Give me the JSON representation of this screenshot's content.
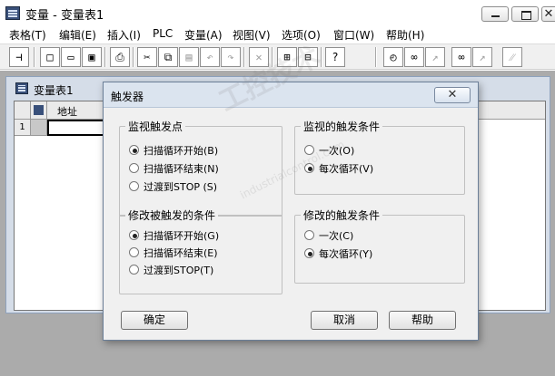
{
  "app": {
    "title": "变量 - 变量表1"
  },
  "menu": [
    "表格(T)",
    "编辑(E)",
    "插入(I)",
    "PLC",
    "变量(A)",
    "视图(V)",
    "选项(O)",
    "窗口(W)",
    "帮助(H)"
  ],
  "child_window": {
    "title": "变量表1",
    "column_address": "地址",
    "row_number": "1"
  },
  "dialog": {
    "title": "触发器",
    "close_glyph": "✕",
    "monitor_trigger_point": {
      "legend": "监视触发点",
      "options": [
        "扫描循环开始(B)",
        "扫描循环结束(N)",
        "过渡到STOP (S)"
      ],
      "selected_index": 0
    },
    "monitor_trigger_condition": {
      "legend": "监视的触发条件",
      "options": [
        "一次(O)",
        "每次循环(V)"
      ],
      "selected_index": 1
    },
    "modify_trigger_point": {
      "legend": "修改被触发的条件",
      "options": [
        "扫描循环开始(G)",
        "扫描循环结束(E)",
        "过渡到STOP(T)"
      ],
      "selected_index": 0
    },
    "modify_trigger_condition": {
      "legend": "修改的触发条件",
      "options": [
        "一次(C)",
        "每次循环(Y)"
      ],
      "selected_index": 1
    },
    "buttons": {
      "ok": "确定",
      "cancel": "取消",
      "help": "帮助"
    }
  },
  "watermark": {
    "line1": "工控技术",
    "line2": "industrialcontrol.com"
  }
}
